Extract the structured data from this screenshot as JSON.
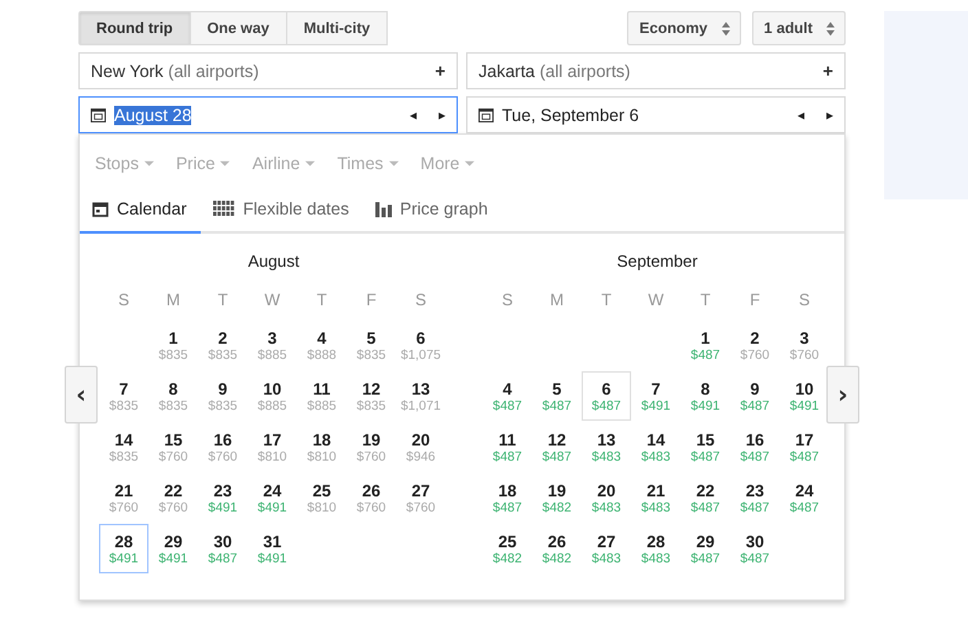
{
  "trip_types": [
    {
      "label": "Round trip",
      "selected": true
    },
    {
      "label": "One way",
      "selected": false
    },
    {
      "label": "Multi-city",
      "selected": false
    }
  ],
  "cabin": {
    "value": "Economy"
  },
  "passengers": {
    "value": "1 adult"
  },
  "origin": {
    "city": "New York",
    "qualifier": "(all airports)",
    "add": "+"
  },
  "destination": {
    "city": "Jakarta",
    "qualifier": "(all airports)",
    "add": "+"
  },
  "departure": {
    "value": "August 28",
    "focused": true,
    "prev": "◂",
    "next": "▸"
  },
  "return": {
    "value": "Tue, September 6",
    "focused": false,
    "prev": "◂",
    "next": "▸"
  },
  "filters": [
    "Stops",
    "Price",
    "Airline",
    "Times",
    "More"
  ],
  "views": [
    {
      "label": "Calendar",
      "selected": true
    },
    {
      "label": "Flexible dates",
      "selected": false
    },
    {
      "label": "Price graph",
      "selected": false
    }
  ],
  "months": [
    {
      "name": "August",
      "kind": "departure",
      "weekdays": [
        "S",
        "M",
        "T",
        "W",
        "T",
        "F",
        "S"
      ],
      "weeks": [
        {
          "kind": "first",
          "days": [
            {
              "day": "1",
              "price": "$835",
              "cheap": false,
              "selected": false
            },
            {
              "day": "2",
              "price": "$835",
              "cheap": false,
              "selected": false
            },
            {
              "day": "3",
              "price": "$885",
              "cheap": false,
              "selected": false
            },
            {
              "day": "4",
              "price": "$888",
              "cheap": false,
              "selected": false
            },
            {
              "day": "5",
              "price": "$835",
              "cheap": false,
              "selected": false
            },
            {
              "day": "6",
              "price": "$1,075",
              "cheap": false,
              "selected": false
            }
          ]
        },
        {
          "kind": "full",
          "days": [
            {
              "day": "7",
              "price": "$835",
              "cheap": false,
              "selected": false
            },
            {
              "day": "8",
              "price": "$835",
              "cheap": false,
              "selected": false
            },
            {
              "day": "9",
              "price": "$835",
              "cheap": false,
              "selected": false
            },
            {
              "day": "10",
              "price": "$885",
              "cheap": false,
              "selected": false
            },
            {
              "day": "11",
              "price": "$885",
              "cheap": false,
              "selected": false
            },
            {
              "day": "12",
              "price": "$835",
              "cheap": false,
              "selected": false
            },
            {
              "day": "13",
              "price": "$1,071",
              "cheap": false,
              "selected": false
            }
          ]
        },
        {
          "kind": "full",
          "days": [
            {
              "day": "14",
              "price": "$835",
              "cheap": false,
              "selected": false
            },
            {
              "day": "15",
              "price": "$760",
              "cheap": false,
              "selected": false
            },
            {
              "day": "16",
              "price": "$760",
              "cheap": false,
              "selected": false
            },
            {
              "day": "17",
              "price": "$810",
              "cheap": false,
              "selected": false
            },
            {
              "day": "18",
              "price": "$810",
              "cheap": false,
              "selected": false
            },
            {
              "day": "19",
              "price": "$760",
              "cheap": false,
              "selected": false
            },
            {
              "day": "20",
              "price": "$946",
              "cheap": false,
              "selected": false
            }
          ]
        },
        {
          "kind": "full",
          "days": [
            {
              "day": "21",
              "price": "$760",
              "cheap": false,
              "selected": false
            },
            {
              "day": "22",
              "price": "$760",
              "cheap": false,
              "selected": false
            },
            {
              "day": "23",
              "price": "$491",
              "cheap": true,
              "selected": false
            },
            {
              "day": "24",
              "price": "$491",
              "cheap": true,
              "selected": false
            },
            {
              "day": "25",
              "price": "$810",
              "cheap": false,
              "selected": false
            },
            {
              "day": "26",
              "price": "$760",
              "cheap": false,
              "selected": false
            },
            {
              "day": "27",
              "price": "$760",
              "cheap": false,
              "selected": false
            }
          ]
        },
        {
          "kind": "full",
          "days": [
            {
              "day": "28",
              "price": "$491",
              "cheap": true,
              "selected": true
            },
            {
              "day": "29",
              "price": "$491",
              "cheap": true,
              "selected": false
            },
            {
              "day": "30",
              "price": "$487",
              "cheap": true,
              "selected": false
            },
            {
              "day": "31",
              "price": "$491",
              "cheap": true,
              "selected": false
            }
          ]
        }
      ]
    },
    {
      "name": "September",
      "kind": "return",
      "weekdays": [
        "S",
        "M",
        "T",
        "W",
        "T",
        "F",
        "S"
      ],
      "weeks": [
        {
          "kind": "first",
          "days": [
            {
              "day": "1",
              "price": "$487",
              "cheap": true,
              "selected": false
            },
            {
              "day": "2",
              "price": "$760",
              "cheap": false,
              "selected": false
            },
            {
              "day": "3",
              "price": "$760",
              "cheap": false,
              "selected": false
            }
          ]
        },
        {
          "kind": "full",
          "days": [
            {
              "day": "4",
              "price": "$487",
              "cheap": true,
              "selected": false
            },
            {
              "day": "5",
              "price": "$487",
              "cheap": true,
              "selected": false
            },
            {
              "day": "6",
              "price": "$487",
              "cheap": true,
              "selected": true
            },
            {
              "day": "7",
              "price": "$491",
              "cheap": true,
              "selected": false
            },
            {
              "day": "8",
              "price": "$491",
              "cheap": true,
              "selected": false
            },
            {
              "day": "9",
              "price": "$487",
              "cheap": true,
              "selected": false
            },
            {
              "day": "10",
              "price": "$491",
              "cheap": true,
              "selected": false
            }
          ]
        },
        {
          "kind": "full",
          "days": [
            {
              "day": "11",
              "price": "$487",
              "cheap": true,
              "selected": false
            },
            {
              "day": "12",
              "price": "$487",
              "cheap": true,
              "selected": false
            },
            {
              "day": "13",
              "price": "$483",
              "cheap": true,
              "selected": false
            },
            {
              "day": "14",
              "price": "$483",
              "cheap": true,
              "selected": false
            },
            {
              "day": "15",
              "price": "$487",
              "cheap": true,
              "selected": false
            },
            {
              "day": "16",
              "price": "$487",
              "cheap": true,
              "selected": false
            },
            {
              "day": "17",
              "price": "$487",
              "cheap": true,
              "selected": false
            }
          ]
        },
        {
          "kind": "full",
          "days": [
            {
              "day": "18",
              "price": "$487",
              "cheap": true,
              "selected": false
            },
            {
              "day": "19",
              "price": "$482",
              "cheap": true,
              "selected": false
            },
            {
              "day": "20",
              "price": "$483",
              "cheap": true,
              "selected": false
            },
            {
              "day": "21",
              "price": "$483",
              "cheap": true,
              "selected": false
            },
            {
              "day": "22",
              "price": "$487",
              "cheap": true,
              "selected": false
            },
            {
              "day": "23",
              "price": "$487",
              "cheap": true,
              "selected": false
            },
            {
              "day": "24",
              "price": "$487",
              "cheap": true,
              "selected": false
            }
          ]
        },
        {
          "kind": "full",
          "days": [
            {
              "day": "25",
              "price": "$482",
              "cheap": true,
              "selected": false
            },
            {
              "day": "26",
              "price": "$482",
              "cheap": true,
              "selected": false
            },
            {
              "day": "27",
              "price": "$483",
              "cheap": true,
              "selected": false
            },
            {
              "day": "28",
              "price": "$483",
              "cheap": true,
              "selected": false
            },
            {
              "day": "29",
              "price": "$487",
              "cheap": true,
              "selected": false
            },
            {
              "day": "30",
              "price": "$487",
              "cheap": true,
              "selected": false
            }
          ]
        }
      ]
    }
  ],
  "nav": {
    "prev": "‹",
    "next": "›"
  }
}
